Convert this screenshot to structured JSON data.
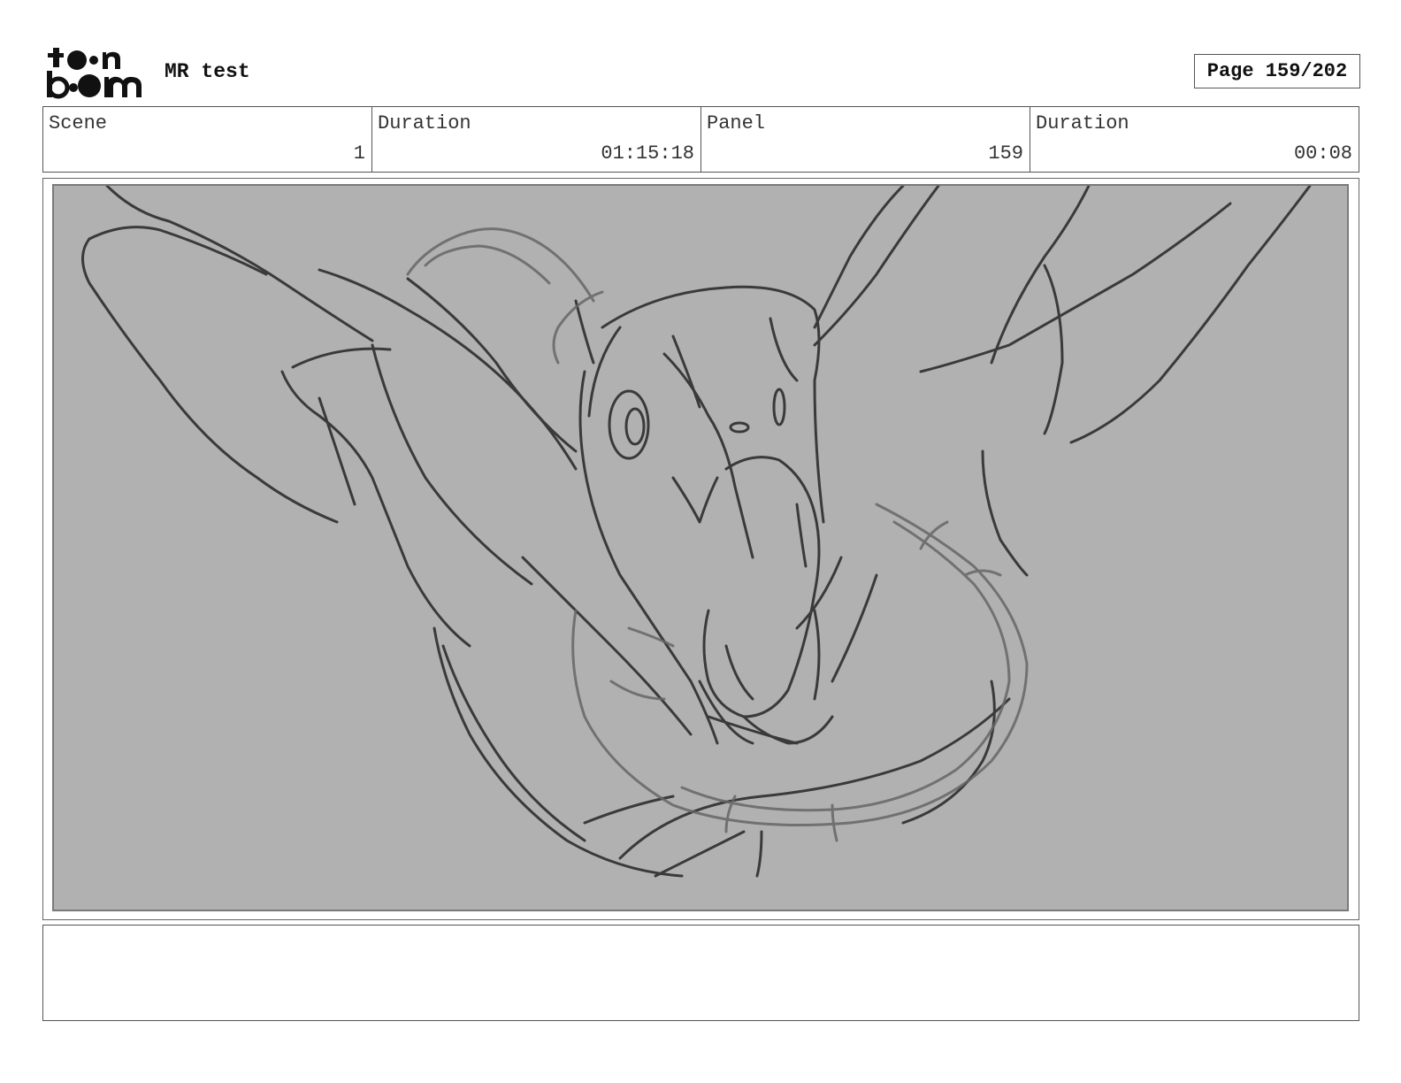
{
  "header": {
    "logo": {
      "line1": "toon",
      "line2": "boom",
      "icon": "toon-boom-logo"
    },
    "project_title": "MR test",
    "page_label": "Page 159/202"
  },
  "info": {
    "scene_label": "Scene",
    "scene_value": "1",
    "scene_duration_label": "Duration",
    "scene_duration_value": "01:15:18",
    "panel_label": "Panel",
    "panel_value": "159",
    "panel_duration_label": "Duration",
    "panel_duration_value": "00:08"
  },
  "panel": {
    "background_color": "#b1b1b1",
    "stroke_color": "#3a3a3a",
    "secondary_stroke_color": "#666666"
  },
  "notes": {
    "text": ""
  }
}
